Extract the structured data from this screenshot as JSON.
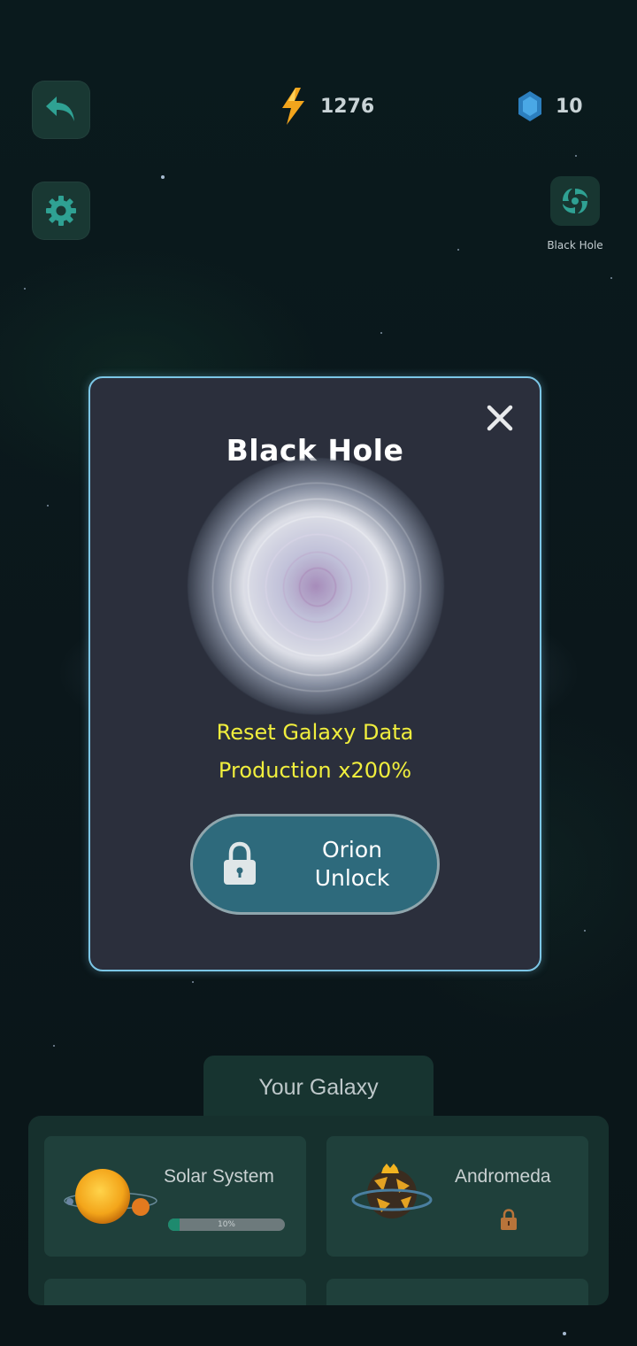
{
  "header": {
    "energy_value": "1276",
    "gem_value": "10",
    "black_hole_label": "Black Hole"
  },
  "icons": {
    "back": "back-arrow-icon",
    "settings": "gear-icon",
    "energy": "lightning-icon",
    "gem": "hexagon-gem-icon",
    "black_hole": "vortex-icon"
  },
  "modal": {
    "title": "Black Hole",
    "line1": "Reset Galaxy Data",
    "line2": "Production x200%",
    "unlock_line1": "Orion",
    "unlock_line2": "Unlock"
  },
  "galaxy": {
    "tab_label": "Your Galaxy",
    "cards": [
      {
        "name": "Solar System",
        "progress": 0.1,
        "progress_label": "10%"
      },
      {
        "name": "Andromeda",
        "locked": true
      }
    ]
  },
  "colors": {
    "accent": "#7cc6e6",
    "highlight_text": "#f0ee3d",
    "button": "#2e6a7c"
  }
}
